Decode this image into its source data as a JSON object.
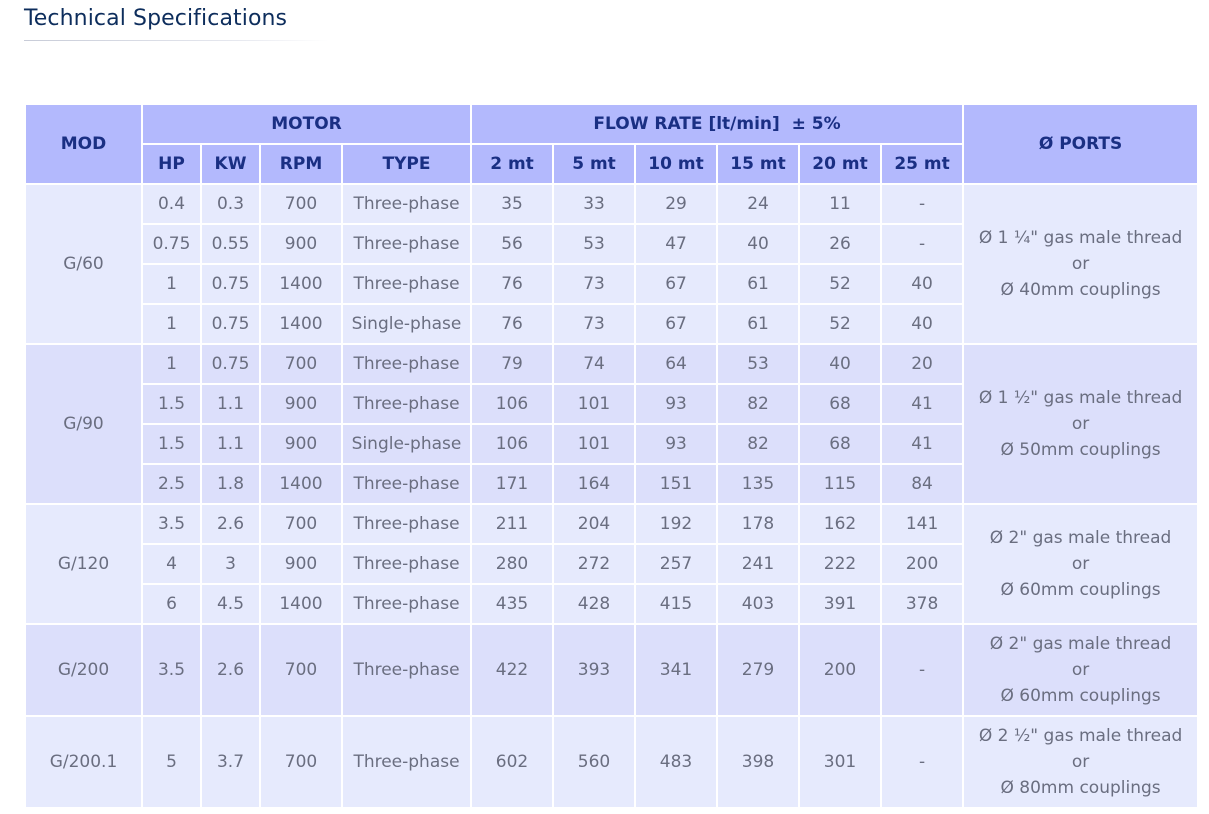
{
  "page": {
    "title": "Technical Specifications"
  },
  "table": {
    "header": {
      "mod": "MOD",
      "motor": "MOTOR",
      "flow_rate": "FLOW RATE [lt/min]  ± 5%",
      "ports": "Ø PORTS",
      "motor_cols": [
        "HP",
        "KW",
        "RPM",
        "TYPE"
      ],
      "flow_cols": [
        "2 mt",
        "5 mt",
        "10 mt",
        "15 mt",
        "20 mt",
        "25 mt"
      ]
    },
    "groups": [
      {
        "model": "G/60",
        "ports": [
          "Ø 1 ¼\" gas male thread",
          "or",
          "Ø 40mm couplings"
        ],
        "rows": [
          [
            "0.4",
            "0.3",
            "700",
            "Three-phase",
            "35",
            "33",
            "29",
            "24",
            "11",
            "-"
          ],
          [
            "0.75",
            "0.55",
            "900",
            "Three-phase",
            "56",
            "53",
            "47",
            "40",
            "26",
            "-"
          ],
          [
            "1",
            "0.75",
            "1400",
            "Three-phase",
            "76",
            "73",
            "67",
            "61",
            "52",
            "40"
          ],
          [
            "1",
            "0.75",
            "1400",
            "Single-phase",
            "76",
            "73",
            "67",
            "61",
            "52",
            "40"
          ]
        ]
      },
      {
        "model": "G/90",
        "ports": [
          "Ø 1 ½\" gas male thread",
          "or",
          "Ø 50mm couplings"
        ],
        "rows": [
          [
            "1",
            "0.75",
            "700",
            "Three-phase",
            "79",
            "74",
            "64",
            "53",
            "40",
            "20"
          ],
          [
            "1.5",
            "1.1",
            "900",
            "Three-phase",
            "106",
            "101",
            "93",
            "82",
            "68",
            "41"
          ],
          [
            "1.5",
            "1.1",
            "900",
            "Single-phase",
            "106",
            "101",
            "93",
            "82",
            "68",
            "41"
          ],
          [
            "2.5",
            "1.8",
            "1400",
            "Three-phase",
            "171",
            "164",
            "151",
            "135",
            "115",
            "84"
          ]
        ]
      },
      {
        "model": "G/120",
        "ports": [
          "Ø 2\" gas male thread",
          "or",
          "Ø 60mm couplings"
        ],
        "rows": [
          [
            "3.5",
            "2.6",
            "700",
            "Three-phase",
            "211",
            "204",
            "192",
            "178",
            "162",
            "141"
          ],
          [
            "4",
            "3",
            "900",
            "Three-phase",
            "280",
            "272",
            "257",
            "241",
            "222",
            "200"
          ],
          [
            "6",
            "4.5",
            "1400",
            "Three-phase",
            "435",
            "428",
            "415",
            "403",
            "391",
            "378"
          ]
        ]
      },
      {
        "model": "G/200",
        "ports": [
          "Ø 2\" gas male thread",
          "or",
          "Ø 60mm couplings"
        ],
        "rows": [
          [
            "3.5",
            "2.6",
            "700",
            "Three-phase",
            "422",
            "393",
            "341",
            "279",
            "200",
            "-"
          ]
        ]
      },
      {
        "model": "G/200.1",
        "ports": [
          "Ø 2 ½\" gas male thread",
          "or",
          "Ø 80mm couplings"
        ],
        "rows": [
          [
            "5",
            "3.7",
            "700",
            "Three-phase",
            "602",
            "560",
            "483",
            "398",
            "301",
            "-"
          ]
        ]
      }
    ]
  }
}
